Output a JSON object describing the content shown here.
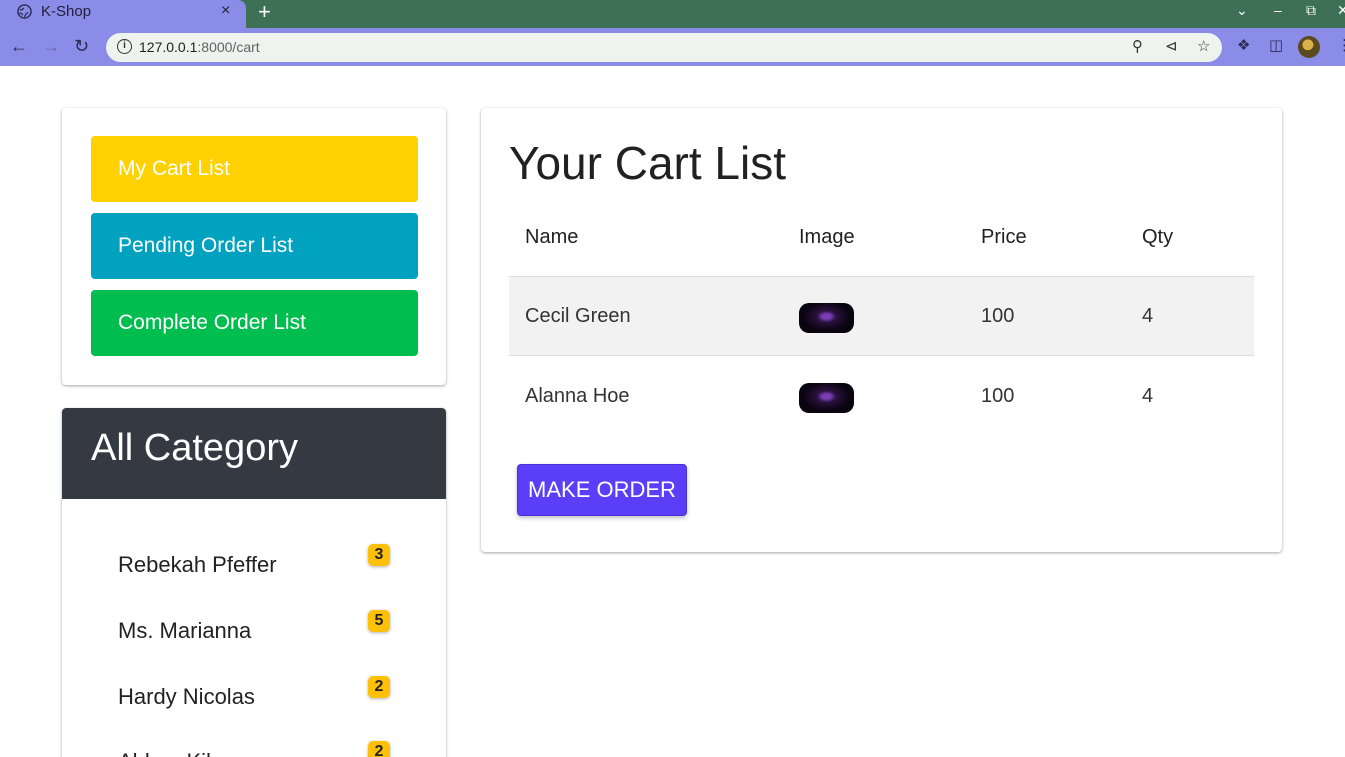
{
  "browser": {
    "tab_title": "K-Shop",
    "tab_close": "×",
    "new_tab": "+",
    "url_host": "127.0.0.1",
    "url_path": ":8000/cart",
    "info": "i"
  },
  "sidebar": {
    "buttons": [
      {
        "label": "My Cart List",
        "color": "#ffd100"
      },
      {
        "label": "Pending Order List",
        "color": "#00a2bf"
      },
      {
        "label": "Complete Order List",
        "color": "#00bd4f"
      }
    ]
  },
  "categories": {
    "title": "All Category",
    "items": [
      {
        "name": "Rebekah Pfeffer",
        "count": "3"
      },
      {
        "name": "Ms. Marianna",
        "count": "5"
      },
      {
        "name": "Hardy Nicolas",
        "count": "2"
      },
      {
        "name": "Abbey Kihn",
        "count": "2"
      }
    ]
  },
  "cart": {
    "title": "Your Cart List",
    "columns": [
      "Name",
      "Image",
      "Price",
      "Qty"
    ],
    "rows": [
      {
        "name": "Cecil Green",
        "price": "100",
        "qty": "4"
      },
      {
        "name": "Alanna Hoe",
        "price": "100",
        "qty": "4"
      }
    ],
    "make_order_label": "MAKE ORDER"
  },
  "colors": {
    "accent": "#5b3ff8",
    "badge": "#ffc107",
    "category_header": "#353942"
  }
}
